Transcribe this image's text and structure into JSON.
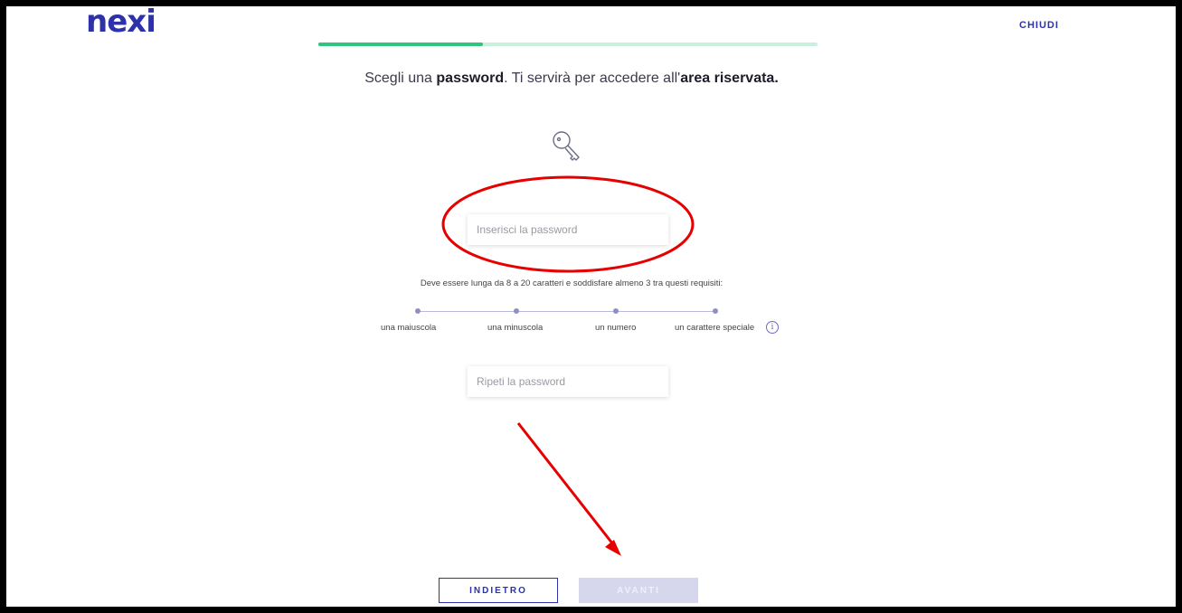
{
  "brand": {
    "logo": "nexi"
  },
  "header": {
    "close_label": "CHIUDI"
  },
  "progress": {
    "value_percent": 33
  },
  "headline": {
    "part1": "Scegli una ",
    "bold1": "password",
    "part2": ". Ti servirà per accedere all'",
    "bold2": "area riservata."
  },
  "password": {
    "placeholder": "Inserisci la password"
  },
  "requirements": {
    "intro": "Deve essere lunga da 8 a 20 caratteri e soddisfare almeno 3 tra questi requisiti:",
    "items": [
      "una maiuscola",
      "una minuscola",
      "un numero",
      "un carattere speciale"
    ],
    "info_glyph": "i"
  },
  "confirm": {
    "placeholder": "Ripeti la password"
  },
  "buttons": {
    "back_label": "INDIETRO",
    "next_label": "AVANTI"
  },
  "colors": {
    "brand": "#2d32aa",
    "progress_fill": "#2fc47f",
    "progress_track": "#c9f0dc",
    "annotation": "#e60000",
    "next_disabled": "#d6d7ec"
  }
}
